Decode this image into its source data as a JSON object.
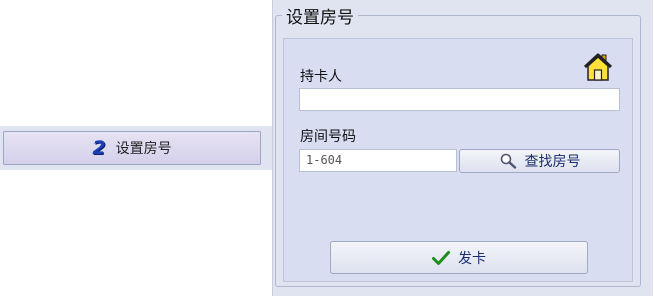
{
  "step": {
    "number": "2",
    "label": "设置房号"
  },
  "group": {
    "title": "设置房号"
  },
  "form": {
    "cardholder_label": "持卡人",
    "cardholder_value": "",
    "room_label": "房间号码",
    "room_value": "1-604",
    "find_button": "查找房号",
    "issue_button": "发卡"
  },
  "icons": {
    "house": "house-icon",
    "find": "magnifier-icon",
    "issue": "checkmark-icon"
  }
}
